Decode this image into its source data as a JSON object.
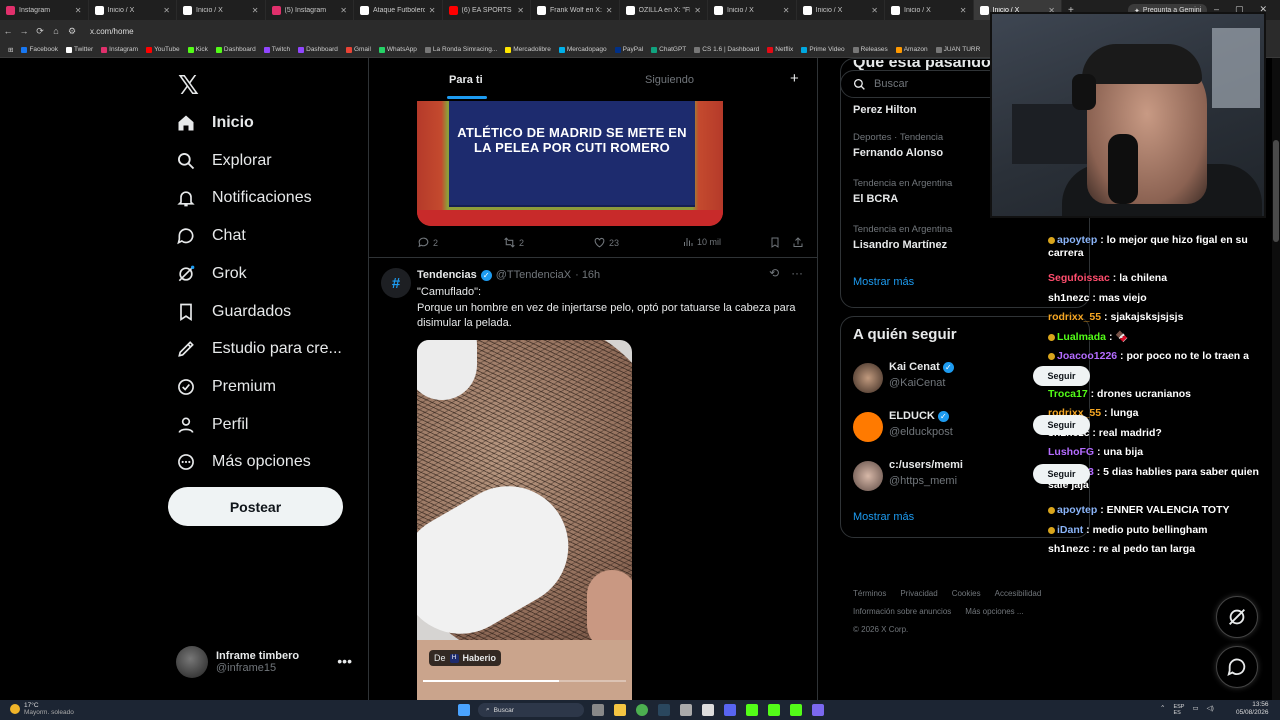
{
  "browser": {
    "tabs": [
      {
        "title": "Instagram",
        "color": "#e1306c"
      },
      {
        "title": "Inicio / X",
        "color": "#ffffff"
      },
      {
        "title": "Inicio / X",
        "color": "#ffffff"
      },
      {
        "title": "(5) Instagram",
        "color": "#e1306c"
      },
      {
        "title": "Ataque Futbolero e",
        "color": "#ffffff"
      },
      {
        "title": "(6) EA SPORTS FC 2",
        "color": "#ff0000"
      },
      {
        "title": "Frank Wolf en X: \"M",
        "color": "#ffffff"
      },
      {
        "title": "OZILLA en X: \"Flocr",
        "color": "#ffffff"
      },
      {
        "title": "Inicio / X",
        "color": "#ffffff"
      },
      {
        "title": "Inicio / X",
        "color": "#ffffff"
      },
      {
        "title": "Inicio / X",
        "color": "#ffffff"
      },
      {
        "title": "Inicio / X",
        "color": "#ffffff"
      }
    ],
    "gemini": "Pregunta a Gemini",
    "url": "x.com/home",
    "bookmarks": [
      {
        "label": "Facebook",
        "color": "#1877f2"
      },
      {
        "label": "Twitter",
        "color": "#ffffff"
      },
      {
        "label": "Instagram",
        "color": "#e1306c"
      },
      {
        "label": "YouTube",
        "color": "#ff0000"
      },
      {
        "label": "Kick",
        "color": "#53fc18"
      },
      {
        "label": "Dashboard",
        "color": "#53fc18"
      },
      {
        "label": "Twitch",
        "color": "#9146ff"
      },
      {
        "label": "Dashboard",
        "color": "#9146ff"
      },
      {
        "label": "Gmail",
        "color": "#ea4335"
      },
      {
        "label": "WhatsApp",
        "color": "#25d366"
      },
      {
        "label": "La Ronda Simracing...",
        "color": "#777777"
      },
      {
        "label": "Mercadolibre",
        "color": "#ffe600"
      },
      {
        "label": "Mercadopago",
        "color": "#00b1ea"
      },
      {
        "label": "PayPal",
        "color": "#003087"
      },
      {
        "label": "ChatGPT",
        "color": "#10a37f"
      },
      {
        "label": "CS 1.6 | Dashboard",
        "color": "#777777"
      },
      {
        "label": "Netflix",
        "color": "#e50914"
      },
      {
        "label": "Prime Video",
        "color": "#00a8e1"
      },
      {
        "label": "Releases",
        "color": "#777777"
      },
      {
        "label": "Amazon",
        "color": "#ff9900"
      },
      {
        "label": "JUAN TURR",
        "color": "#777777"
      }
    ]
  },
  "nav": {
    "items": [
      "Inicio",
      "Explorar",
      "Notificaciones",
      "Chat",
      "Grok",
      "Guardados",
      "Estudio para cre...",
      "Premium",
      "Perfil",
      "Más opciones"
    ],
    "post_label": "Postear",
    "profile_name": "Inframe timbero",
    "profile_handle": "@inframe15"
  },
  "feed": {
    "tab_foryou": "Para ti",
    "tab_following": "Siguiendo",
    "news_card_title": "ATLÉTICO DE MADRID SE METE EN LA PELEA POR CUTI ROMERO",
    "prev_actions": {
      "replies": "2",
      "reposts": "2",
      "likes": "23",
      "views": "10 mil"
    },
    "tweet": {
      "name": "Tendencias",
      "handle": "@TTendenciaX",
      "time": "· 16h",
      "text1": "\"Camuflado\":",
      "text2": "Porque un hombre en vez de injertarse pelo, optó por tatuarse la cabeza para disimular la pelada.",
      "credit_prefix": "De",
      "credit_name": "Haberio",
      "video_progress": 0.67
    }
  },
  "right": {
    "search_placeholder": "Buscar",
    "trends_title": "Qué está pasando",
    "trends": [
      {
        "context": "",
        "name": "Perez Hilton"
      },
      {
        "context": "Deportes · Tendencia",
        "name": "Fernando Alonso"
      },
      {
        "context": "Tendencia en Argentina",
        "name": "El BCRA"
      },
      {
        "context": "Tendencia en Argentina",
        "name": "Lisandro Martínez"
      }
    ],
    "show_more": "Mostrar más",
    "follow_title": "A quién seguir",
    "follow": [
      {
        "name": "Kai Cenat",
        "handle": "@KaiCenat",
        "verified": true,
        "button": "Seguir"
      },
      {
        "name": "ELDUCK",
        "handle": "@elduckpost",
        "verified": true,
        "button": "Seguir"
      },
      {
        "name": "c:/users/memi",
        "handle": "@https_memi",
        "verified": false,
        "button": "Seguir"
      }
    ],
    "footer": [
      "Términos",
      "Privacidad",
      "Cookies",
      "Accesibilidad",
      "Información sobre anuncios",
      "Más opciones ...",
      "© 2026 X Corp."
    ]
  },
  "chat": [
    {
      "user": "apoytep",
      "color": "#8ab4f8",
      "msg": ": lo mejor que hizo figal en su carrera",
      "badge": true
    },
    {
      "user": "Segufoissac",
      "color": "#ff4d6d",
      "msg": ": la chilena",
      "badge": false
    },
    {
      "user": "sh1nezc",
      "color": "#ffffff",
      "msg": ": mas viejo",
      "badge": false
    },
    {
      "user": "rodrixx_55",
      "color": "#f5a623",
      "msg": ": sjakajsksjsjsjs",
      "badge": false
    },
    {
      "user": "Lualmada",
      "color": "#53fc18",
      "msg": ": 🍫",
      "badge": true
    },
    {
      "user": "Joacoo1226",
      "color": "#b46cff",
      "msg": ": por poco no te lo traen a",
      "badge": true
    },
    {
      "user": "Troca17",
      "color": "#53fc18",
      "msg": ": drones ucranianos",
      "badge": false
    },
    {
      "user": "rodrixx_55",
      "color": "#f5a623",
      "msg": ": lunga",
      "badge": false
    },
    {
      "user": "sh1nezc",
      "color": "#ffffff",
      "msg": ": real madrid?",
      "badge": false
    },
    {
      "user": "LushoFG",
      "color": "#b46cff",
      "msg": ": una bija",
      "badge": false
    },
    {
      "user": "Necs13",
      "color": "#b46cff",
      "msg": ": 5 dias hablies para saber quien sale jaja",
      "badge": true
    },
    {
      "user": "apoytep",
      "color": "#8ab4f8",
      "msg": ": ENNER VALENCIA TOTY",
      "badge": true
    },
    {
      "user": "iDant",
      "color": "#8ab4f8",
      "msg": ": medio puto bellingham",
      "badge": true
    },
    {
      "user": "sh1nezc",
      "color": "#ffffff",
      "msg": ": re al pedo tan larga",
      "badge": false
    }
  ],
  "taskbar": {
    "weather_temp": "17°C",
    "weather_desc": "Mayorm. soleado",
    "search": "Buscar",
    "lang": "ESP\nES",
    "time": "13:56",
    "date": "05/08/2026"
  }
}
